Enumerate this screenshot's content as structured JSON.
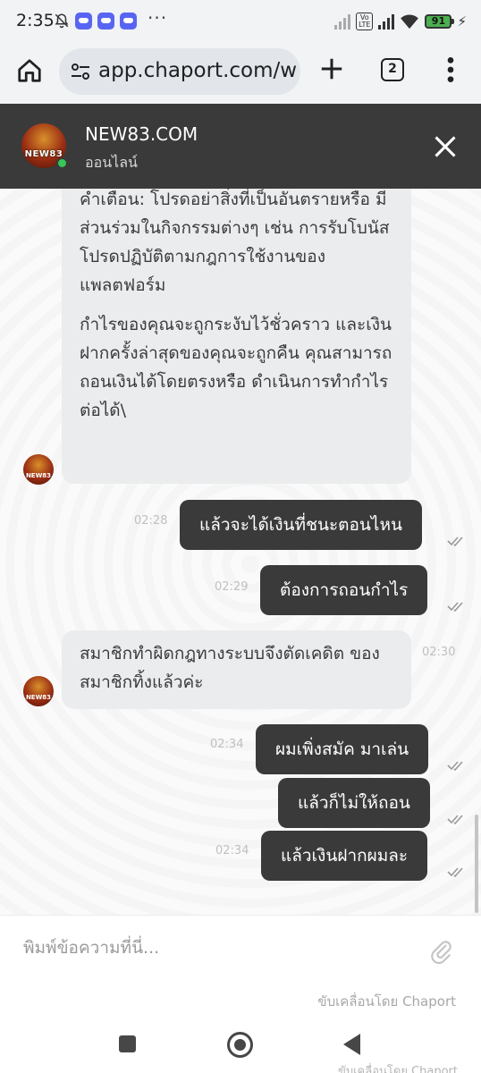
{
  "status_bar": {
    "time": "2:35",
    "battery": "91",
    "icons": [
      "bell-off-icon",
      "discord-icon",
      "discord-icon",
      "discord-icon",
      "more-dots",
      "signal-icon",
      "volte-icon",
      "signal-icon",
      "wifi-icon",
      "battery-icon",
      "charging-icon"
    ]
  },
  "browser": {
    "url": "app.chaport.com/w",
    "tab_count": "2",
    "icons": [
      "home-icon",
      "site-settings-icon",
      "plus-icon",
      "tabs-icon",
      "more-vert-icon"
    ]
  },
  "chat_header": {
    "title": "NEW83.COM",
    "status": "ออนไลน์",
    "logo_text": "NEW83",
    "online_color": "#38c656",
    "background": "#3a3a3a"
  },
  "messages": [
    {
      "direction": "incoming",
      "paragraphs": [
        "คำเตือน: โปรดอย่าสิ่งที่เป็นอันตรายหรือ มีส่วนร่วมในกิจกรรมต่างๆ เช่น การรับโบนัส โปรดปฏิบัติตามกฎการใช้งานของแพลตฟอร์ม",
        "กำไรของคุณจะถูกระงับไว้ชั่วคราว และเงินฝากครั้งล่าสุดของคุณจะถูกคืน คุณสามารถถอนเงินได้โดยตรงหรือ ดำเนินการทำกำไรต่อได้\\"
      ]
    },
    {
      "direction": "outgoing",
      "text": "แล้วจะได้เงินที่ชนะตอนไหน",
      "time": "02:28",
      "read": true
    },
    {
      "direction": "outgoing",
      "text": "ต้องการถอนกำไร",
      "time": "02:29",
      "read": true
    },
    {
      "direction": "incoming",
      "text": "สมาชิกทำผิดกฎทางระบบจึงตัดเคดิต ของสมาชิกทิ้งแล้วค่ะ",
      "time": "02:30"
    },
    {
      "direction": "outgoing",
      "text": "ผมเพิ่งสมัค มาเล่น",
      "time": "02:34",
      "read": true
    },
    {
      "direction": "outgoing",
      "text": "แล้วก็ไม่ให้ถอน",
      "time": "",
      "read": true
    },
    {
      "direction": "outgoing",
      "text": "แล้วเงินฝากผมละ",
      "time": "02:34",
      "read": true
    }
  ],
  "composer": {
    "placeholder": "พิมพ์ข้อความที่นี่...",
    "powered_by": "ขับเคลื่อนโดย Chaport"
  },
  "nav": {
    "ghost_text": "ขับเคลื่อนโดย Chaport"
  }
}
